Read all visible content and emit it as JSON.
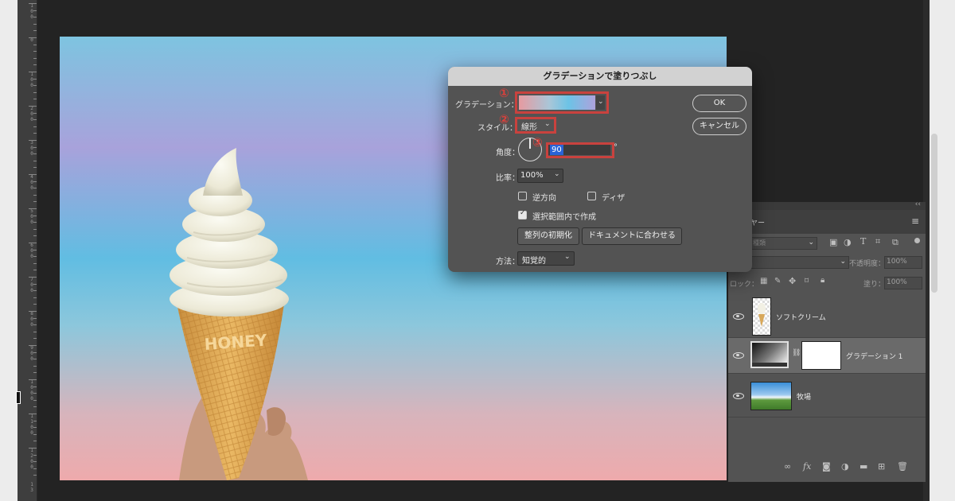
{
  "ruler": {
    "labels": [
      "1\n0\n0",
      "0",
      "1\n0\n0",
      "2\n0\n0",
      "3\n0\n0",
      "4\n0\n0",
      "5\n0\n0",
      "6\n0\n0",
      "7\n0\n0",
      "8\n0\n0",
      "9\n0\n0",
      "1\n0\n0\n0",
      "1\n1\n0\n0",
      "1\n2\n0\n0",
      "1\n3"
    ]
  },
  "dialog": {
    "title": "グラデーションで塗りつぶし",
    "gradient_label": "グラデーション：",
    "style_label": "スタイル：",
    "style_value": "線形",
    "angle_label": "角度：",
    "angle_value": "90",
    "degree_symbol": "°",
    "scale_label": "比率：",
    "scale_value": "100%",
    "reverse_label": "逆方向",
    "dither_label": "ディザ",
    "align_label": "選択範囲内で作成",
    "reset_align_button": "整列の初期化",
    "fit_document_button": "ドキュメントに合わせる",
    "method_label": "方法：",
    "method_value": "知覚的",
    "ok_button": "OK",
    "cancel_button": "キャンセル",
    "checkboxes": {
      "reverse": false,
      "dither": false,
      "align_with_layer": true
    },
    "annotations": [
      "①",
      "②",
      "③"
    ],
    "annotation_color": "#c9423e"
  },
  "layers_panel": {
    "tab_label": "ヤー",
    "filter_placeholder": "種類",
    "opacity_label": "不透明度：",
    "opacity_value": "100%",
    "lock_label": "ロック：",
    "fill_label": "塗り：",
    "fill_value": "100%",
    "layers": [
      {
        "name": "ソフトクリーム",
        "visible": true,
        "selected": false
      },
      {
        "name": "グラデーション 1",
        "visible": true,
        "selected": true
      },
      {
        "name": "牧場",
        "visible": true,
        "selected": false
      }
    ],
    "footer_icons": [
      "link-icon",
      "fx-icon",
      "mask-icon",
      "adjustment-icon",
      "folder-icon",
      "new-layer-icon",
      "trash-icon"
    ]
  },
  "icon_names": [
    "eye-icon",
    "chain-link-icon",
    "lock-icon",
    "brush-icon",
    "move-icon",
    "artboard-icon",
    "chevron-down-icon",
    "hamburger-icon",
    "collapse-icon"
  ]
}
